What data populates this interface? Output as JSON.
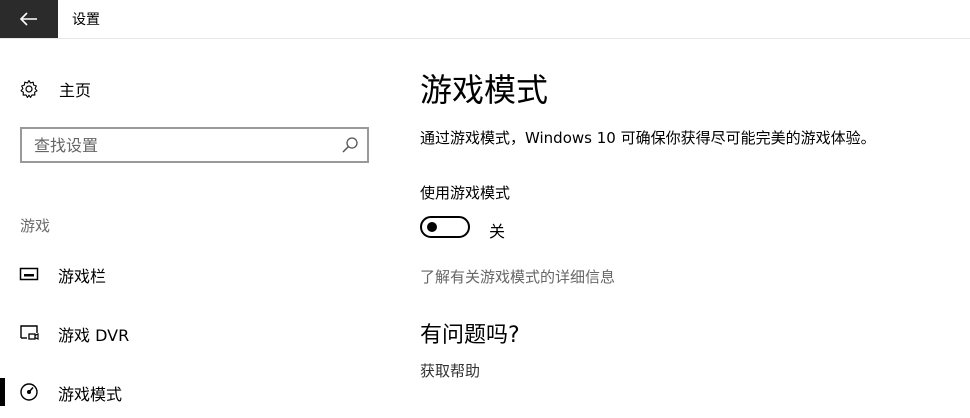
{
  "window": {
    "title": "设置",
    "back_icon": "arrow-left-icon"
  },
  "sidebar": {
    "home": {
      "label": "主页",
      "icon": "gear-icon"
    },
    "search": {
      "placeholder": "查找设置",
      "value": "",
      "icon": "search-icon"
    },
    "section_label": "游戏",
    "items": [
      {
        "label": "游戏栏",
        "icon": "game-bar-icon",
        "selected": false
      },
      {
        "label": "游戏 DVR",
        "icon": "game-dvr-icon",
        "selected": false
      },
      {
        "label": "游戏模式",
        "icon": "game-mode-icon",
        "selected": true
      }
    ]
  },
  "main": {
    "title": "游戏模式",
    "description": "通过游戏模式，Windows 10 可确保你获得尽可能完美的游戏体验。",
    "toggle": {
      "label": "使用游戏模式",
      "state_text": "关",
      "on": false
    },
    "learn_more": "了解有关游戏模式的详细信息",
    "question_heading": "有问题吗?",
    "help_link": "获取帮助"
  },
  "colors": {
    "back_button_bg": "#2b2b2b",
    "link_gray": "#666666",
    "search_border": "#999999",
    "section_gray": "#6b6b6b"
  }
}
